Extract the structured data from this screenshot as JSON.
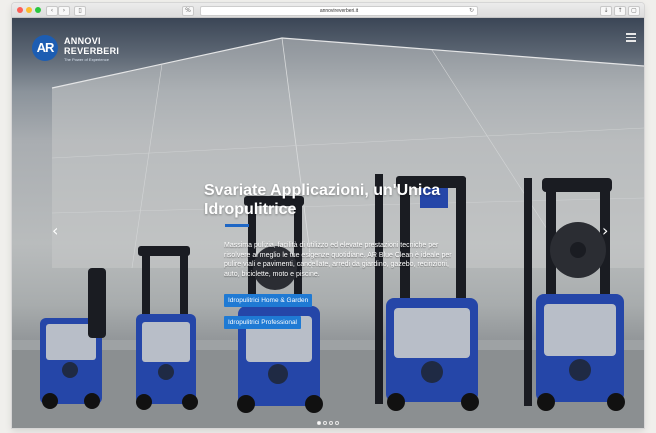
{
  "browser": {
    "address": "annovireverberi.it",
    "reload_icon": "reload-icon",
    "nav_icons": [
      "back-icon",
      "forward-icon",
      "sidebar-icon"
    ],
    "right_icons": [
      "download-icon",
      "share-icon",
      "tabs-icon"
    ]
  },
  "site": {
    "logo_mark": "AR",
    "logo_name_line1": "ANNOVI",
    "logo_name_line2": "REVERBERI",
    "logo_tagline": "The Power of Experience",
    "menu_icon": "hamburger-menu-icon"
  },
  "hero": {
    "title": "Svariate Applicazioni, un'Unica Idropulitrice",
    "description": "Massima pulizia, facilità di utilizzo ed elevate prestazioni tecniche per risolvere al meglio le tue esigenze quotidiane. AR Blue Clean è ideale per pulire viali e pavimenti, cancellate, arredi da giardino, gazebo, recinzioni, auto, biciclette, moto e piscine.",
    "buttons": [
      {
        "label": "Idropulitrici Home & Garden"
      },
      {
        "label": "Idropulitrici Professional"
      }
    ],
    "prev_icon": "chevron-left-icon",
    "next_icon": "chevron-right-icon",
    "slide_count": 4,
    "active_slide": 1
  },
  "colors": {
    "brand_blue": "#1d5db2",
    "button_blue": "#1f7ad4",
    "product_blue": "#2546a8"
  }
}
